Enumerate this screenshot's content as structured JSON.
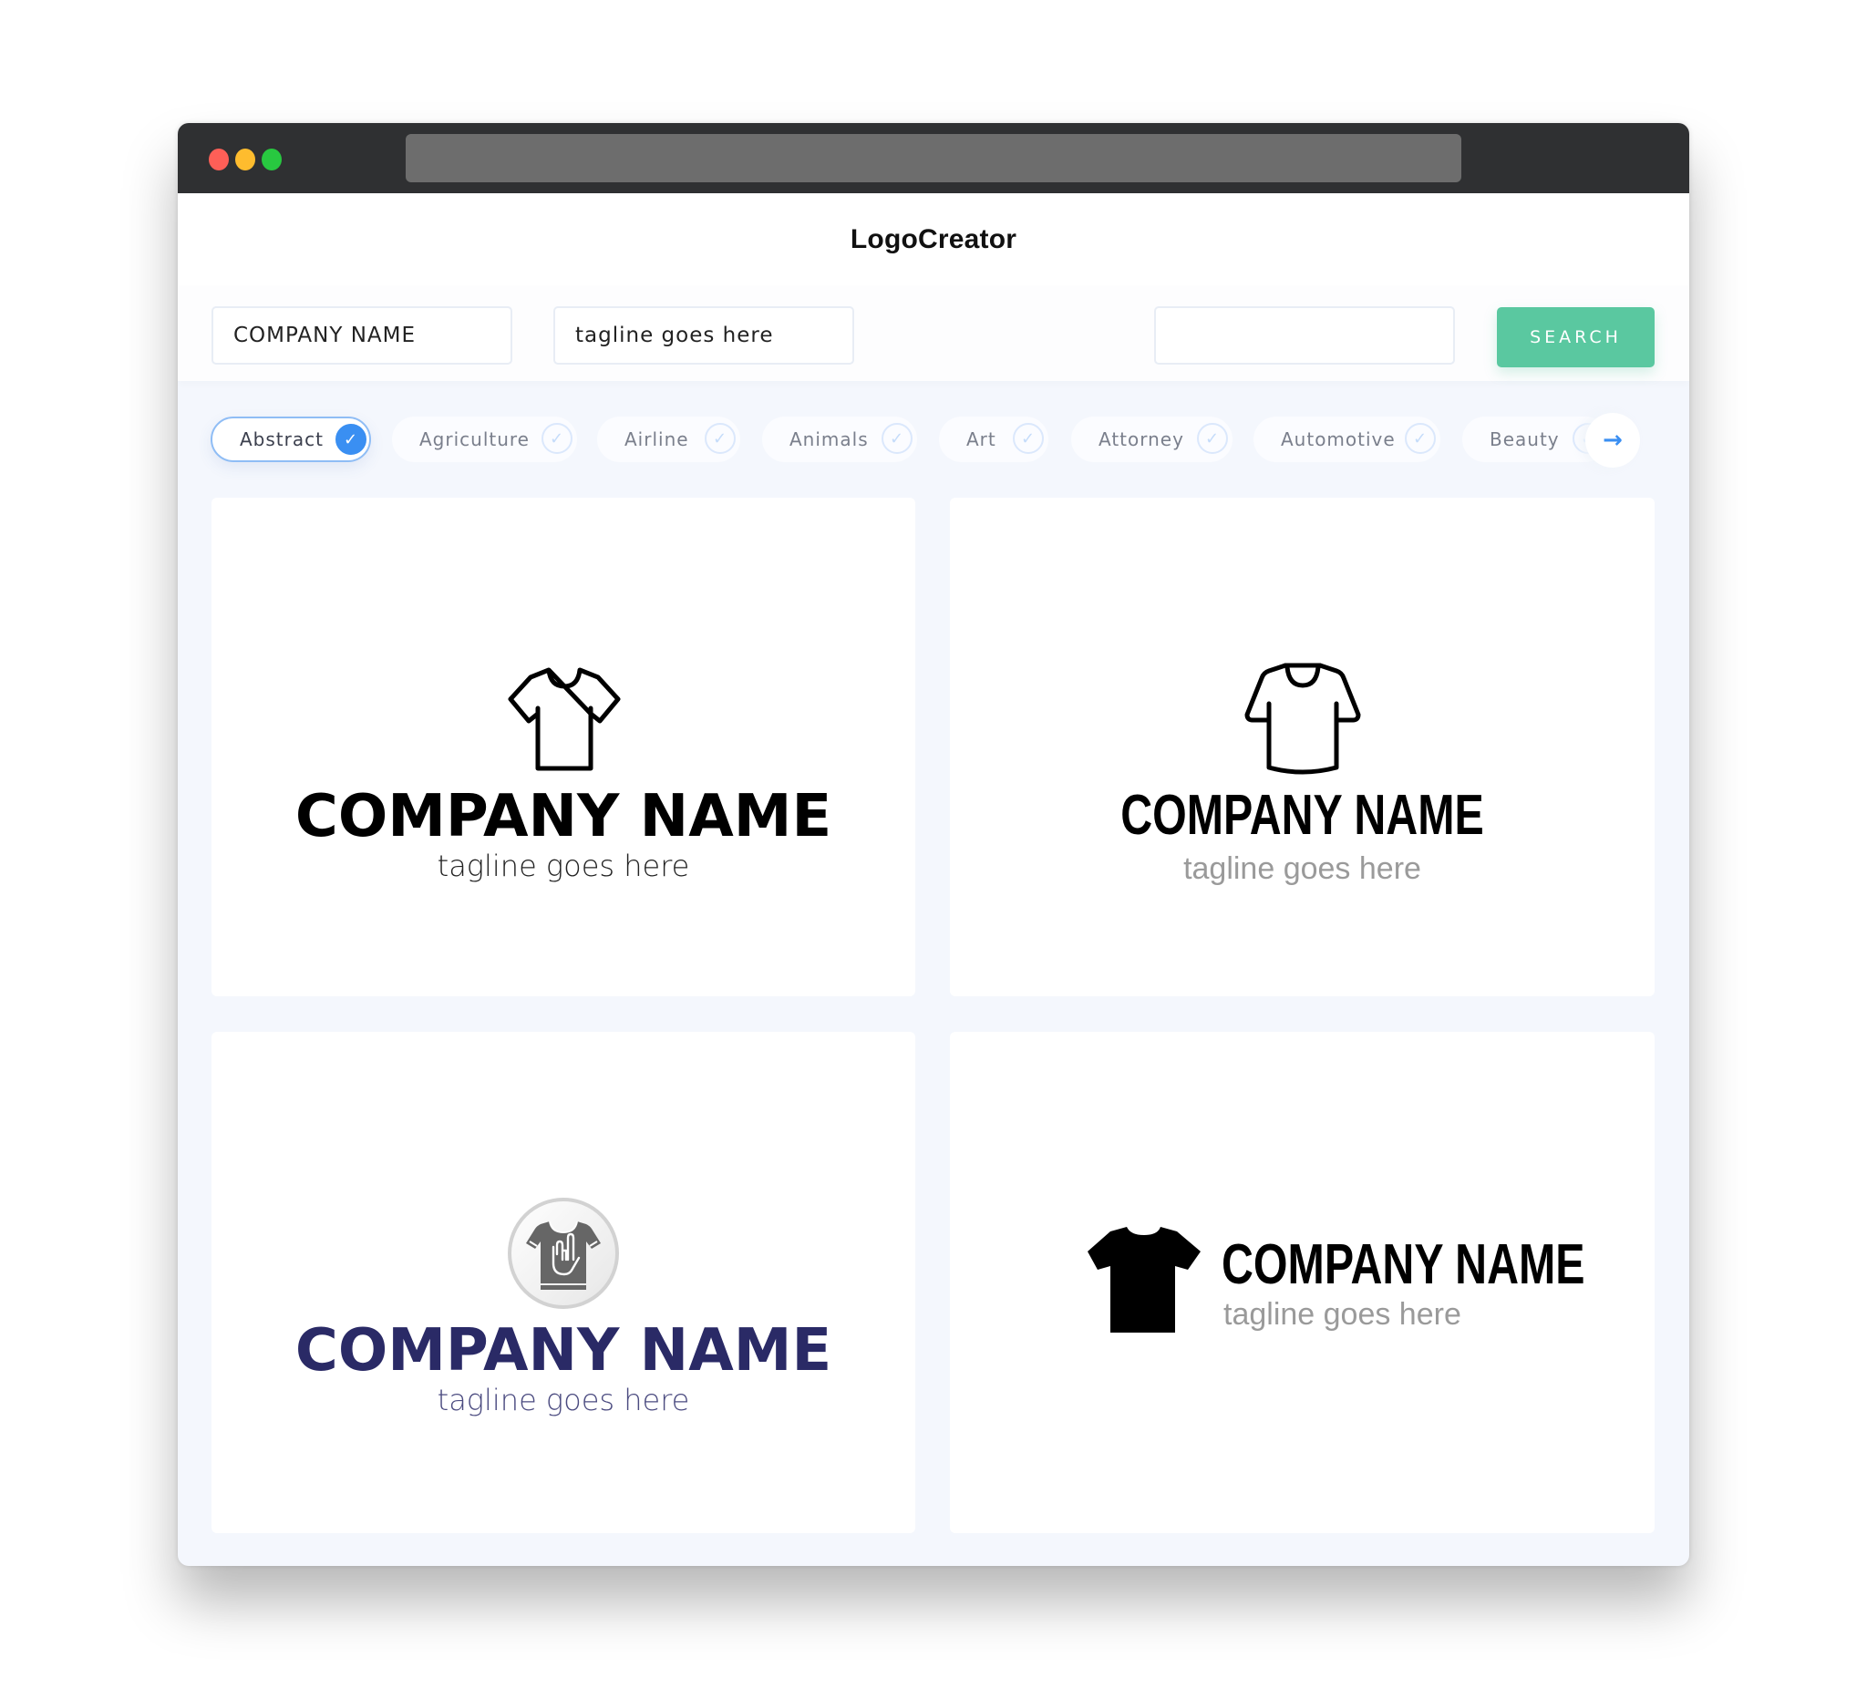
{
  "app": {
    "title": "LogoCreator",
    "window_controls": [
      "close",
      "minimize",
      "maximize"
    ]
  },
  "search": {
    "company_name_value": "COMPANY NAME",
    "tagline_value": "tagline goes here",
    "query_value": "",
    "search_button_label": "SEARCH"
  },
  "categories": [
    {
      "label": "Abstract",
      "selected": true
    },
    {
      "label": "Agriculture",
      "selected": false
    },
    {
      "label": "Airline",
      "selected": false
    },
    {
      "label": "Animals",
      "selected": false
    },
    {
      "label": "Art",
      "selected": false
    },
    {
      "label": "Attorney",
      "selected": false
    },
    {
      "label": "Automotive",
      "selected": false
    },
    {
      "label": "Beauty",
      "selected": false
    }
  ],
  "icons": {
    "check": "✓",
    "next_arrow": "→"
  },
  "colors": {
    "accent_blue": "#3a8ff2",
    "search_green": "#5ac8a0",
    "navy": "#2a2a66",
    "navy_tagline": "#4b4b80",
    "titlebar": "#2f3032"
  },
  "logos": [
    {
      "company": "COMPANY NAME",
      "tagline": "tagline goes here",
      "icon": "tshirt-outline-icon"
    },
    {
      "company": "COMPANY NAME",
      "tagline": "tagline goes here",
      "icon": "tshirt-ringneck-outline-icon"
    },
    {
      "company": "COMPANY NAME",
      "tagline": "tagline goes here",
      "icon": "rock-hand-tshirt-badge-icon"
    },
    {
      "company": "COMPANY NAME",
      "tagline": "tagline goes here",
      "icon": "tshirt-solid-icon"
    }
  ]
}
